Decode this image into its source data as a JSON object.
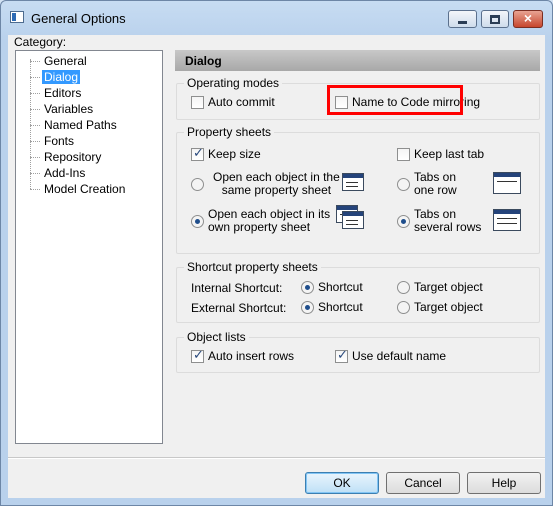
{
  "window": {
    "title": "General Options",
    "close_glyph": "×"
  },
  "category": {
    "label": "Category:",
    "items": [
      "General",
      "Dialog",
      "Editors",
      "Variables",
      "Named Paths",
      "Fonts",
      "Repository",
      "Add-Ins",
      "Model Creation"
    ],
    "selected": "Dialog"
  },
  "panel": {
    "header": "Dialog"
  },
  "operating_modes": {
    "label": "Operating modes",
    "auto_commit": {
      "label": "Auto commit",
      "checked": false
    },
    "name_to_code": {
      "label": "Name to Code mirroring",
      "checked": false
    }
  },
  "property_sheets": {
    "label": "Property sheets",
    "keep_size": {
      "label": "Keep size",
      "checked": true
    },
    "keep_last_tab": {
      "label": "Keep last tab",
      "checked": false
    },
    "open_same_line1": "Open each object in the",
    "open_same_line2": "same property sheet",
    "open_own_line1": "Open each object in its",
    "open_own_line2": "own property sheet",
    "tabs_one_line1": "Tabs on",
    "tabs_one_line2": "one row",
    "tabs_several_line1": "Tabs on",
    "tabs_several_line2": "several rows",
    "open_mode_selected": "own",
    "tabs_mode_selected": "several"
  },
  "shortcut": {
    "label": "Shortcut property sheets",
    "internal_label": "Internal Shortcut:",
    "external_label": "External Shortcut:",
    "shortcut_option": "Shortcut",
    "target_option": "Target object",
    "internal_selected": "Shortcut",
    "external_selected": "Shortcut"
  },
  "object_lists": {
    "label": "Object lists",
    "auto_insert": {
      "label": "Auto insert rows",
      "checked": true
    },
    "default_name": {
      "label": "Use default name",
      "checked": true
    }
  },
  "buttons": {
    "ok": "OK",
    "cancel": "Cancel",
    "help": "Help"
  },
  "colors": {
    "highlight": "#ff0000",
    "selection": "#3399ff"
  },
  "icons": [
    "app-icon",
    "minimize-icon",
    "maximize-icon",
    "close-icon",
    "checkmark-icon",
    "property-sheet-icon"
  ]
}
